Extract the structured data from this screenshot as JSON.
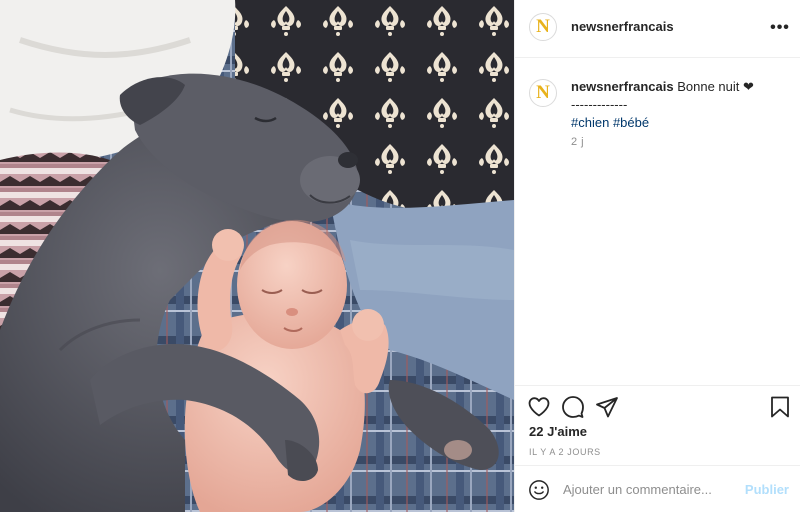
{
  "post": {
    "username": "newsnerfrancais",
    "avatar_letter": "N",
    "more_icon": "more-horizontal-icon",
    "caption": {
      "username": "newsnerfrancais",
      "text": "Bonne nuit ❤",
      "divider": "-------------",
      "hashtags": [
        "#chien",
        "#bébé"
      ]
    },
    "time_ago": "2 j",
    "photo_alt": "Dog sleeping next to a newborn baby",
    "actions": {
      "like_icon": "heart-icon",
      "comment_icon": "comment-bubble-icon",
      "share_icon": "paper-plane-icon",
      "save_icon": "bookmark-icon"
    },
    "likes": "22 J'aime",
    "date": "IL Y A 2 JOURS",
    "comment": {
      "emoji_icon": "smiley-face-icon",
      "placeholder": "Ajouter un commentaire...",
      "post_label": "Publier"
    }
  },
  "colors": {
    "border": "#efefef",
    "text": "#262626",
    "muted": "#8e8e8e",
    "hashtag": "#00376b",
    "publish_disabled": "#b2dffc",
    "avatar_letter": "#e8b21c"
  }
}
